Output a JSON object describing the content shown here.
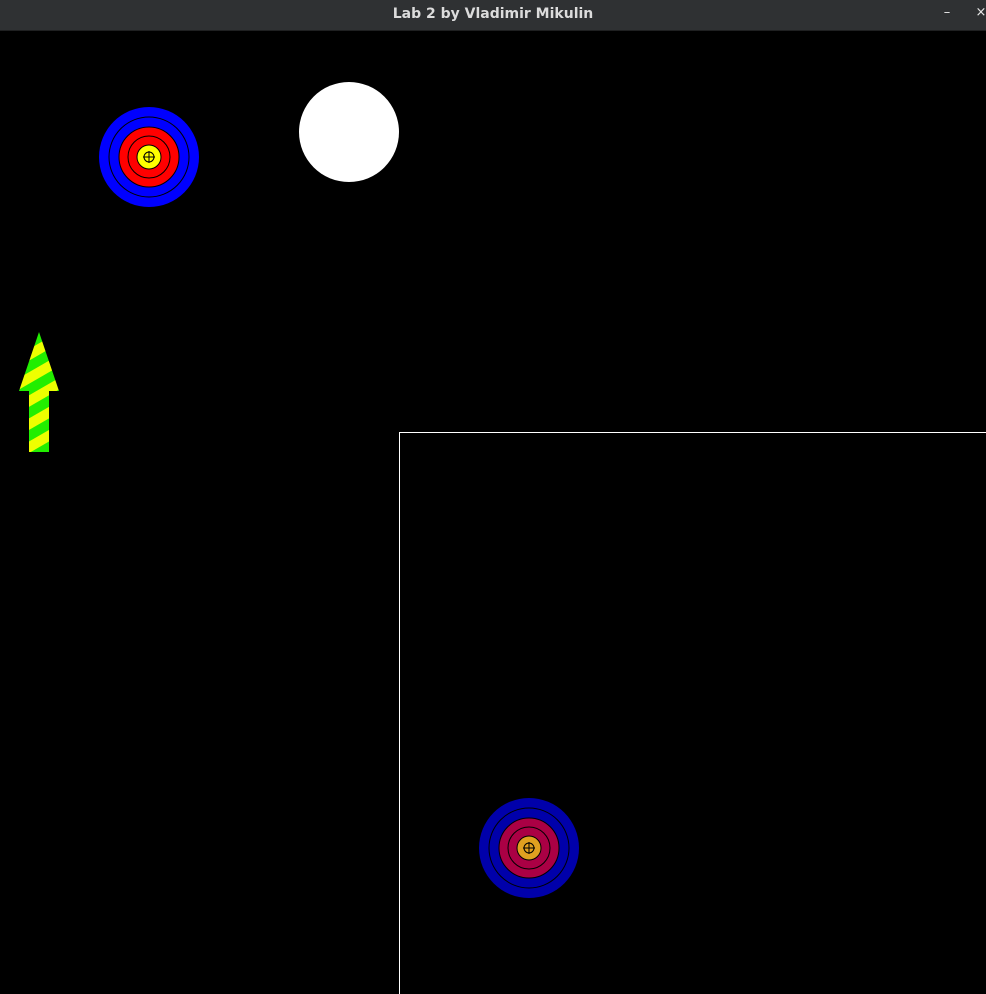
{
  "window": {
    "title": "Lab 2 by Vladimir Mikulin",
    "minimize_icon": "minimize-icon",
    "close_icon": "close-icon",
    "minimize_glyph": "–",
    "close_glyph": "×"
  },
  "scene": {
    "background": "#000000",
    "target_top": {
      "rings": [
        "#0000ff",
        "#0000ff",
        "#ff0000",
        "#ff0000",
        "#ffff00"
      ],
      "center_icon": "crosshair-icon"
    },
    "moon": {
      "color": "#ffffff"
    },
    "arrow": {
      "colors": [
        "#00ff00",
        "#ffff00"
      ],
      "direction": "up"
    },
    "panel": {
      "border_color": "#ffffff"
    },
    "target_bottom": {
      "rings": [
        "#0000aa",
        "#0000aa",
        "#aa0044",
        "#aa0044",
        "#e0a020"
      ],
      "center_icon": "crosshair-icon"
    }
  }
}
